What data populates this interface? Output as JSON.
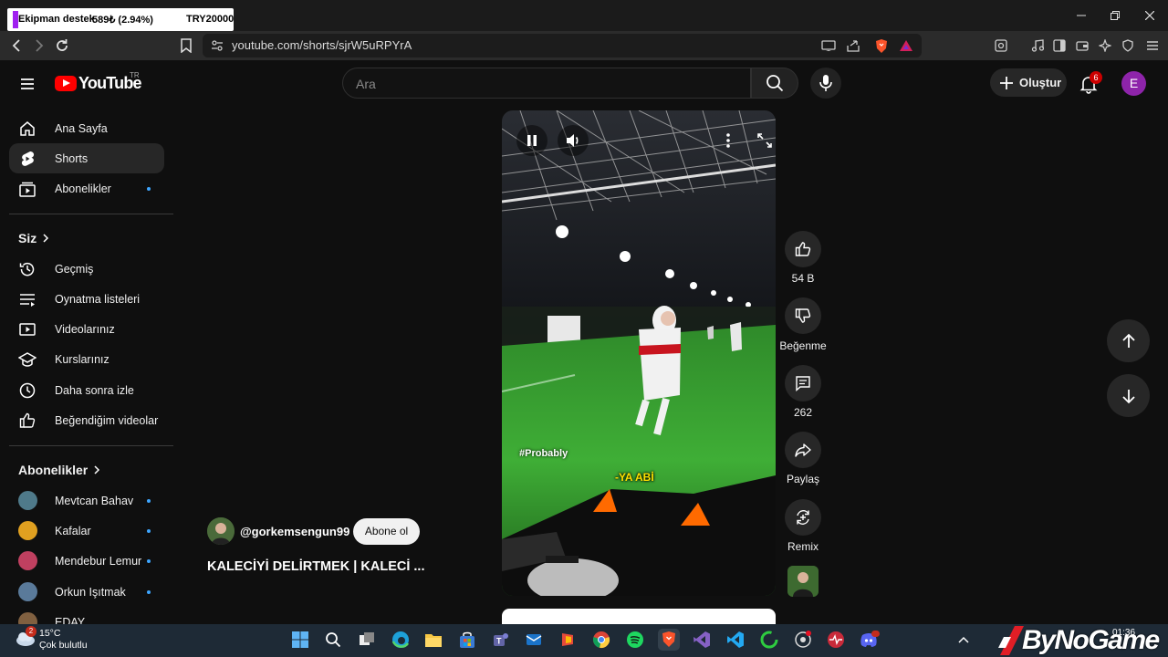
{
  "browser": {
    "tab": {
      "text1": "Ekipman destek",
      "text2": "589₺ (2.94%)",
      "text3": "TRY20000"
    },
    "url": "youtube.com/shorts/sjrW5uRPYrA"
  },
  "header": {
    "logo_word": "YouTube",
    "country_code": "TR",
    "search_placeholder": "Ara",
    "create_label": "Oluştur",
    "notification_count": "6",
    "avatar_letter": "E"
  },
  "sidebar": {
    "main": [
      {
        "label": "Ana Sayfa",
        "icon": "home-icon"
      },
      {
        "label": "Shorts",
        "icon": "shorts-icon",
        "active": true
      },
      {
        "label": "Abonelikler",
        "icon": "subscriptions-icon",
        "dot": true
      }
    ],
    "you_title": "Siz",
    "you": [
      {
        "label": "Geçmiş",
        "icon": "history-icon"
      },
      {
        "label": "Oynatma listeleri",
        "icon": "playlists-icon"
      },
      {
        "label": "Videolarınız",
        "icon": "your-videos-icon"
      },
      {
        "label": "Kurslarınız",
        "icon": "courses-icon"
      },
      {
        "label": "Daha sonra izle",
        "icon": "watch-later-icon"
      },
      {
        "label": "Beğendiğim videolar",
        "icon": "liked-videos-icon"
      }
    ],
    "subs_title": "Abonelikler",
    "subs": [
      {
        "label": "Mevtcan Bahav",
        "color": "#4f7a8a"
      },
      {
        "label": "Kafalar",
        "color": "#e0a020"
      },
      {
        "label": "Mendebur Lemur",
        "color": "#c04060"
      },
      {
        "label": "Orkun Işıtmak",
        "color": "#5a7a9a"
      },
      {
        "label": "EDAY",
        "color": "#806040"
      }
    ]
  },
  "short": {
    "hashtag": "#Probably",
    "caption": "-YA ABİ",
    "channel": "@gorkemsengun99",
    "subscribe_label": "Abone ol",
    "title": "KALECİYİ DELİRTMEK | KALECİ ...",
    "actions": {
      "like_count": "54 B",
      "dislike_label": "Beğenme",
      "comment_count": "262",
      "share_label": "Paylaş",
      "remix_label": "Remix"
    }
  },
  "taskbar": {
    "weather_temp": "15°C",
    "weather_desc": "Çok bulutlu",
    "weather_badge": "2",
    "clock": "01:36",
    "watermark": "ByNoGame"
  },
  "colors": {
    "background": "#0f0f0f",
    "accent_red": "#ff0000",
    "avatar": "#8e24aa",
    "dot_blue": "#3ea6ff"
  }
}
